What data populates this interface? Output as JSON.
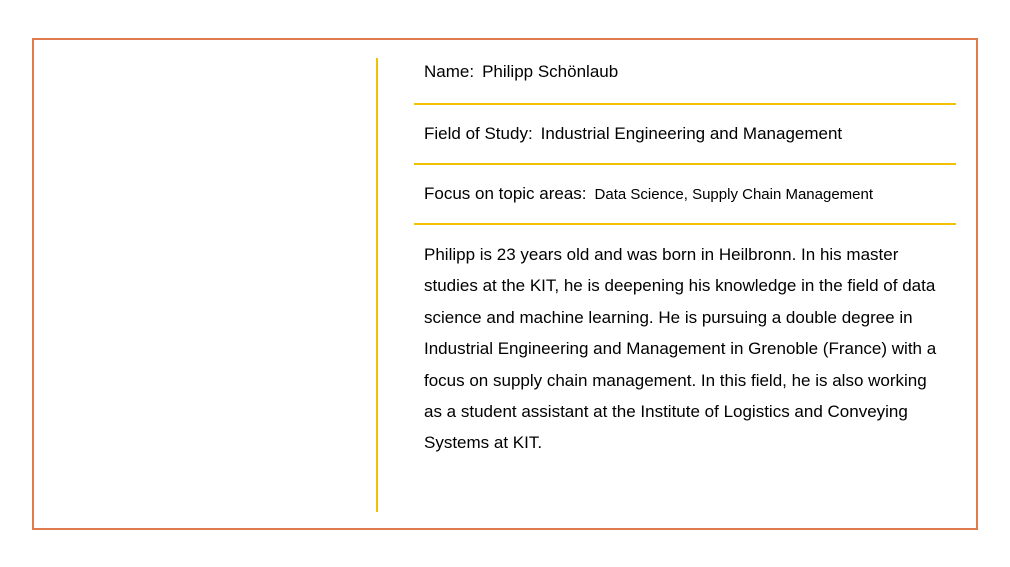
{
  "profile": {
    "name_label": "Name:",
    "name_value": "Philipp Schönlaub",
    "study_label": "Field of Study:",
    "study_value": "Industrial Engineering and Management",
    "focus_label": "Focus on topic areas:",
    "focus_value": "Data Science, Supply Chain Management",
    "bio": "Philipp is 23 years old and was born in Heilbronn. In his master studies at the KIT, he is deepening his knowledge in the field of data science and machine learning. He is pursuing a double degree in Industrial Engineering and Management in Grenoble (France) with a focus on supply chain management. In this field, he is also working as a student assistant at the Institute of Logistics and Conveying Systems at KIT."
  },
  "colors": {
    "frame_border": "#e07a4f",
    "accent_lines": "#f2c200"
  }
}
